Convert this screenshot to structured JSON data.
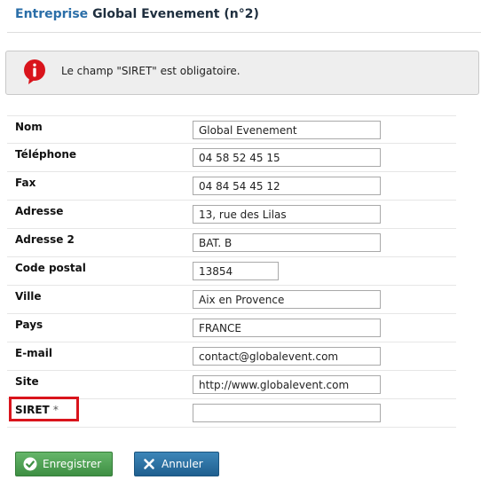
{
  "header": {
    "entity_label": "Entreprise",
    "company_title": "Global Evenement (n°2)"
  },
  "alert": {
    "icon": "exclamation-circle-icon",
    "color": "#d9141c",
    "message": "Le champ \"SIRET\" est obligatoire."
  },
  "form": {
    "fields": [
      {
        "label": "Nom",
        "value": "Global Evenement"
      },
      {
        "label": "Téléphone",
        "value": "04 58 52 45 15"
      },
      {
        "label": "Fax",
        "value": "04 84 54 45 12"
      },
      {
        "label": "Adresse",
        "value": "13, rue des Lilas"
      },
      {
        "label": "Adresse 2",
        "value": "BAT. B"
      },
      {
        "label": "Code postal",
        "value": "13854"
      },
      {
        "label": "Ville",
        "value": "Aix en Provence"
      },
      {
        "label": "Pays",
        "value": "FRANCE"
      },
      {
        "label": "E-mail",
        "value": "contact@globalevent.com"
      },
      {
        "label": "Site",
        "value": "http://www.globalevent.com"
      },
      {
        "label": "SIRET",
        "required_marker": "*",
        "value": ""
      }
    ]
  },
  "buttons": {
    "save_label": "Enregistrer",
    "save_icon": "checkmark-icon",
    "save_color": "#4ea452",
    "cancel_label": "Annuler",
    "cancel_icon": "x-icon",
    "cancel_color": "#2d72a3"
  }
}
